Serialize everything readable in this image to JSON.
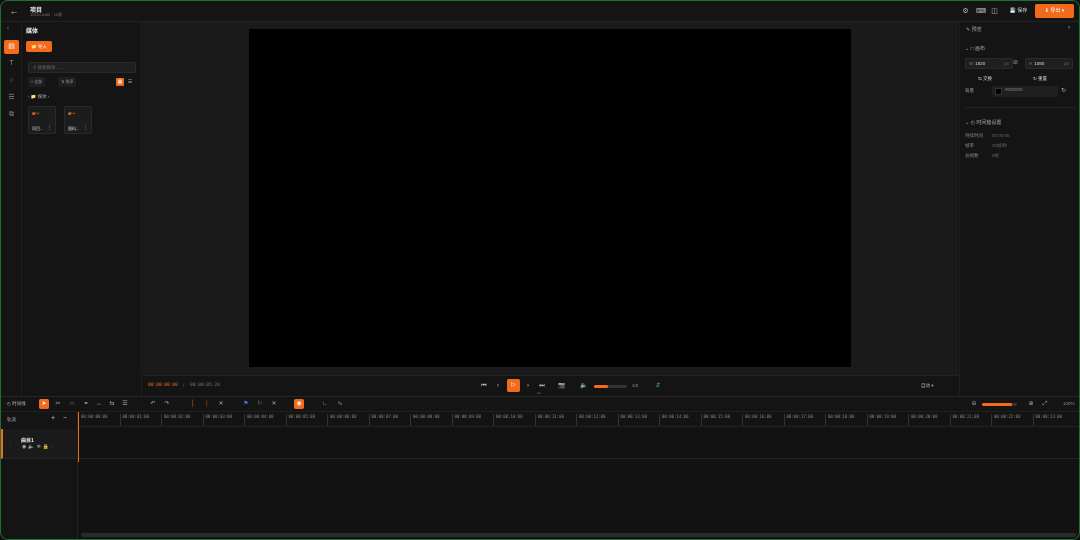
{
  "header": {
    "title": "项目",
    "subtitle": "1920×1080 · 10帧",
    "save_label": "保存",
    "export_label": "导出"
  },
  "media_panel": {
    "title": "媒体",
    "import_label": "导入",
    "search_placeholder": "搜索媒体……",
    "filter_label": "全部",
    "sort_label": "排序",
    "folder_label": "媒体",
    "items": [
      {
        "label": "项目..."
      },
      {
        "label": "图料..."
      }
    ]
  },
  "preview": {
    "current_time": "00:00:00:00",
    "separator": "/",
    "total_time": "00:00:05:20",
    "volume_value": "4/5",
    "volume_fraction": 0.42,
    "fit_label": "自动"
  },
  "properties": {
    "title": "预览",
    "canvas_section": "画布",
    "width_label": "W",
    "width_value": "1920",
    "height_label": "H",
    "height_value": "1080",
    "unit": "px",
    "swap_label": "交换",
    "reset_label": "重置",
    "background_label": "背景",
    "background_hex": "#000000",
    "timeline_section": "时间轴设置",
    "info": [
      {
        "label": "持续时间",
        "value": "00:00:05"
      },
      {
        "label": "帧率",
        "value": "30帧/秒"
      },
      {
        "label": "总帧数",
        "value": "0帧"
      }
    ]
  },
  "timeline": {
    "label": "时间线",
    "track_header_label": "轨道",
    "track_name": "曲目1",
    "zoom_value": "100%",
    "zoom_fraction": 0.85,
    "ticks": [
      "00:00:00:00",
      "00:00:01:00",
      "00:00:02:00",
      "00:00:03:00",
      "00:00:04:00",
      "00:00:05:00",
      "00:00:06:00",
      "00:00:07:00",
      "00:00:08:00",
      "00:00:09:00",
      "00:00:10:00",
      "00:00:11:00",
      "00:00:12:00",
      "00:00:13:00",
      "00:00:14:00",
      "00:00:15:00",
      "00:00:16:00",
      "00:00:17:00",
      "00:00:18:00",
      "00:00:19:00",
      "00:00:20:00",
      "00:00:21:00",
      "00:00:22:00",
      "00:00:23:00"
    ]
  },
  "colors": {
    "accent": "#f26b1d",
    "window_border": "#1f6f35"
  }
}
